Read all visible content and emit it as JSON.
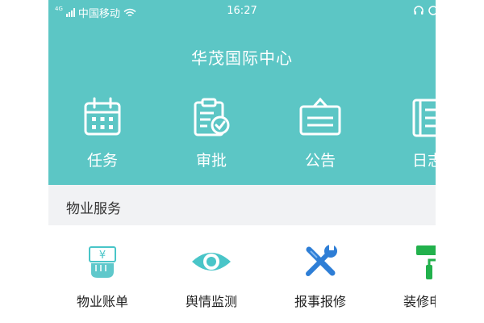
{
  "status_bar": {
    "network": "4G",
    "carrier": "中国移动",
    "time": "16:27",
    "icons": [
      "signal-icon",
      "wifi-icon",
      "headset-icon",
      "alarm-icon"
    ]
  },
  "header": {
    "title": "华茂国际中心",
    "background_color": "#5cc6c5",
    "shortcuts": [
      {
        "label": "任务",
        "icon": "calendar-icon"
      },
      {
        "label": "审批",
        "icon": "clipboard-check-icon"
      },
      {
        "label": "公告",
        "icon": "notice-board-icon"
      },
      {
        "label": "日志",
        "icon": "log-book-icon"
      }
    ]
  },
  "section": {
    "title": "物业服务"
  },
  "services": [
    {
      "label": "物业账单",
      "icon": "bill-hand-icon"
    },
    {
      "label": "舆情监测",
      "icon": "eye-icon"
    },
    {
      "label": "报事报修",
      "icon": "wrench-screwdriver-icon"
    },
    {
      "label": "装修申请",
      "icon": "paint-roller-icon"
    }
  ],
  "colors": {
    "accent": "#5cc6c5",
    "icon_blue": "#2e7ed6",
    "icon_teal": "#49c5c8",
    "icon_green": "#22b14c"
  }
}
